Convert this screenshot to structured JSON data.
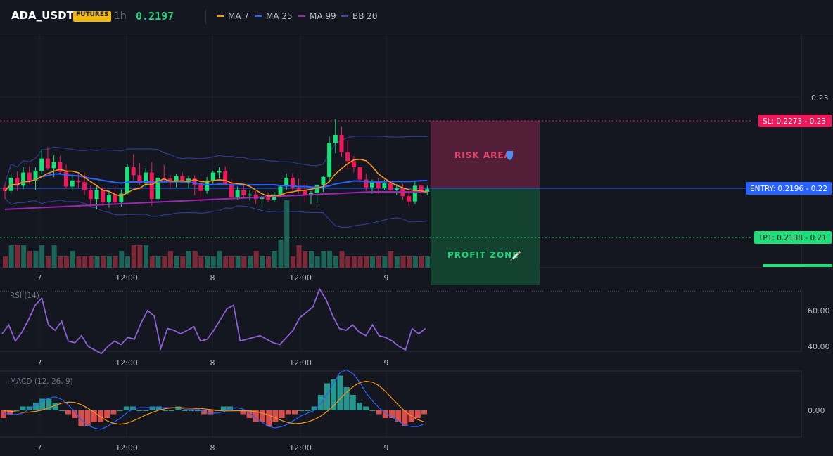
{
  "header": {
    "symbol": "ADA_USDT",
    "badge": "FUTURES",
    "timeframe": "1h",
    "price": "0.2197",
    "indicators": [
      {
        "label": "MA 7",
        "color": "#f7931a"
      },
      {
        "label": "MA 25",
        "color": "#2962ff"
      },
      {
        "label": "MA 99",
        "color": "#9c27b0"
      },
      {
        "label": "BB 20",
        "color": "#3949ab"
      }
    ]
  },
  "price_axis": {
    "ticks": [
      "0.23"
    ]
  },
  "levels": {
    "sl": {
      "label": "SL: 0.2273",
      "axis": "0.23",
      "color": "#f0185a"
    },
    "entry": {
      "label": "ENTRY: 0.2196",
      "axis": "0.22",
      "color": "#2962ff"
    },
    "tp1": {
      "label": "TP1: 0.2138",
      "axis": "0.21",
      "color": "#1ee07a"
    }
  },
  "zones": {
    "risk": {
      "label": "RISK AREA",
      "icon": "shield-icon"
    },
    "profit": {
      "label": "PROFIT ZONE",
      "icon": "rocket-icon"
    }
  },
  "time_axis": [
    "7",
    "12:00",
    "8",
    "12:00",
    "9"
  ],
  "rsi": {
    "title": "RSI (14)",
    "ticks": [
      "60.00",
      "40.00"
    ]
  },
  "macd": {
    "title": "MACD (12, 26, 9)",
    "ticks": [
      "0.00"
    ]
  },
  "chart_data": {
    "type": "candlestick",
    "symbol": "ADA_USDT",
    "interval": "1h",
    "candles": [
      [
        0.2197,
        0.2201,
        0.2184,
        0.2193
      ],
      [
        0.2193,
        0.2213,
        0.219,
        0.2208
      ],
      [
        0.2208,
        0.2215,
        0.2193,
        0.2199
      ],
      [
        0.2199,
        0.222,
        0.2195,
        0.2214
      ],
      [
        0.2214,
        0.2221,
        0.2201,
        0.2205
      ],
      [
        0.2205,
        0.222,
        0.2194,
        0.2216
      ],
      [
        0.2216,
        0.2241,
        0.2212,
        0.223
      ],
      [
        0.223,
        0.2243,
        0.2217,
        0.2219
      ],
      [
        0.2219,
        0.2234,
        0.2209,
        0.2226
      ],
      [
        0.2226,
        0.2233,
        0.2212,
        0.2215
      ],
      [
        0.2215,
        0.2223,
        0.2196,
        0.2198
      ],
      [
        0.2198,
        0.2211,
        0.2193,
        0.2205
      ],
      [
        0.2205,
        0.2213,
        0.2196,
        0.2203
      ],
      [
        0.2203,
        0.2214,
        0.2189,
        0.2194
      ],
      [
        0.2194,
        0.22,
        0.2175,
        0.2184
      ],
      [
        0.2184,
        0.22,
        0.2172,
        0.2194
      ],
      [
        0.2194,
        0.2199,
        0.2176,
        0.218
      ],
      [
        0.218,
        0.2193,
        0.2174,
        0.2188
      ],
      [
        0.2188,
        0.2198,
        0.2177,
        0.218
      ],
      [
        0.218,
        0.2195,
        0.2175,
        0.219
      ],
      [
        0.219,
        0.2224,
        0.2188,
        0.222
      ],
      [
        0.222,
        0.2235,
        0.2205,
        0.2211
      ],
      [
        0.2211,
        0.2225,
        0.22,
        0.2202
      ],
      [
        0.2202,
        0.2219,
        0.2198,
        0.2214
      ],
      [
        0.2214,
        0.2226,
        0.2176,
        0.2184
      ],
      [
        0.2184,
        0.2211,
        0.218,
        0.2208
      ],
      [
        0.2208,
        0.2223,
        0.2203,
        0.2207
      ],
      [
        0.2207,
        0.2211,
        0.2195,
        0.2204
      ],
      [
        0.2204,
        0.2212,
        0.2197,
        0.221
      ],
      [
        0.221,
        0.2214,
        0.2202,
        0.2205
      ],
      [
        0.2205,
        0.221,
        0.2196,
        0.2207
      ],
      [
        0.2207,
        0.2211,
        0.2188,
        0.22
      ],
      [
        0.22,
        0.2208,
        0.2181,
        0.2193
      ],
      [
        0.2193,
        0.2209,
        0.219,
        0.2205
      ],
      [
        0.2205,
        0.2216,
        0.2201,
        0.2214
      ],
      [
        0.2214,
        0.222,
        0.2207,
        0.2216
      ],
      [
        0.2216,
        0.2221,
        0.2199,
        0.2201
      ],
      [
        0.2201,
        0.2206,
        0.2182,
        0.2186
      ],
      [
        0.2186,
        0.2198,
        0.2183,
        0.2194
      ],
      [
        0.2194,
        0.22,
        0.2185,
        0.2188
      ],
      [
        0.2188,
        0.2194,
        0.2182,
        0.2189
      ],
      [
        0.2189,
        0.2193,
        0.2178,
        0.2184
      ],
      [
        0.2184,
        0.2189,
        0.2175,
        0.2186
      ],
      [
        0.2186,
        0.2191,
        0.218,
        0.2183
      ],
      [
        0.2183,
        0.2192,
        0.218,
        0.2189
      ],
      [
        0.2189,
        0.22,
        0.2187,
        0.2198
      ],
      [
        0.2198,
        0.2213,
        0.2194,
        0.2208
      ],
      [
        0.2208,
        0.2213,
        0.2193,
        0.2196
      ],
      [
        0.2196,
        0.2207,
        0.219,
        0.2194
      ],
      [
        0.2194,
        0.2202,
        0.218,
        0.2188
      ],
      [
        0.2188,
        0.2193,
        0.2178,
        0.2191
      ],
      [
        0.2191,
        0.2198,
        0.2179,
        0.22
      ],
      [
        0.22,
        0.221,
        0.2192,
        0.2209
      ],
      [
        0.2209,
        0.2255,
        0.2205,
        0.2248
      ],
      [
        0.2248,
        0.2275,
        0.2236,
        0.2257
      ],
      [
        0.2257,
        0.2266,
        0.2232,
        0.2237
      ],
      [
        0.2237,
        0.2251,
        0.2218,
        0.2227
      ],
      [
        0.2227,
        0.2233,
        0.2214,
        0.222
      ],
      [
        0.222,
        0.2223,
        0.2203,
        0.2206
      ],
      [
        0.2206,
        0.2213,
        0.2193,
        0.2197
      ],
      [
        0.2197,
        0.2206,
        0.219,
        0.2204
      ],
      [
        0.2204,
        0.2208,
        0.219,
        0.2196
      ],
      [
        0.2196,
        0.2206,
        0.2194,
        0.2202
      ],
      [
        0.2202,
        0.2205,
        0.2192,
        0.2194
      ],
      [
        0.2194,
        0.2201,
        0.2188,
        0.2196
      ],
      [
        0.2196,
        0.2201,
        0.2183,
        0.2187
      ],
      [
        0.2187,
        0.2192,
        0.2176,
        0.2181
      ],
      [
        0.2181,
        0.2204,
        0.2178,
        0.2199
      ],
      [
        0.2199,
        0.2203,
        0.219,
        0.2192
      ],
      [
        0.2192,
        0.2199,
        0.2188,
        0.2195
      ]
    ],
    "volumes": [
      2,
      4,
      4,
      4,
      3,
      3,
      4,
      2,
      4,
      2,
      2,
      3,
      2,
      2,
      2,
      2,
      2,
      2,
      2,
      3,
      2,
      4,
      4,
      4,
      2,
      2,
      2,
      3,
      2,
      2,
      3,
      3,
      2,
      2,
      2,
      3,
      2,
      2,
      2,
      2,
      2,
      3,
      2,
      2,
      3,
      5,
      12,
      2,
      4,
      3,
      3,
      2,
      3,
      3,
      2,
      3,
      2,
      2,
      2,
      2,
      2,
      2,
      2,
      3,
      2,
      2,
      2,
      2,
      2,
      2
    ],
    "levels": {
      "sl": 0.2273,
      "entry": 0.2196,
      "tp1": 0.2138
    },
    "rsi": [
      47,
      52,
      43,
      48,
      55,
      63,
      67,
      52,
      49,
      54,
      43,
      42,
      46,
      40,
      38,
      36,
      40,
      43,
      41,
      45,
      44,
      53,
      60,
      57,
      39,
      50,
      49,
      47,
      49,
      51,
      43,
      44,
      49,
      55,
      61,
      63,
      43,
      44,
      45,
      46,
      44,
      42,
      41,
      45,
      49,
      56,
      59,
      62,
      72,
      66,
      57,
      50,
      49,
      52,
      48,
      46,
      52,
      46,
      45,
      43,
      40,
      38,
      50,
      47,
      50
    ],
    "macd_hist": [
      -2,
      -1,
      0,
      1,
      1,
      2,
      3,
      3,
      2,
      0,
      -1,
      -2,
      -4,
      -4,
      -3,
      -3,
      -2,
      -1,
      0,
      1,
      1,
      0,
      0,
      1,
      1,
      0,
      0,
      1,
      0,
      0,
      0,
      -1,
      -1,
      0,
      1,
      1,
      0,
      -1,
      -2,
      -3,
      -3,
      -4,
      -3,
      -2,
      -1,
      -1,
      0,
      0,
      1,
      4,
      7,
      8,
      9,
      6,
      4,
      2,
      1,
      0,
      -1,
      -2,
      -2,
      -3,
      -4,
      -3,
      -2,
      -1
    ]
  }
}
